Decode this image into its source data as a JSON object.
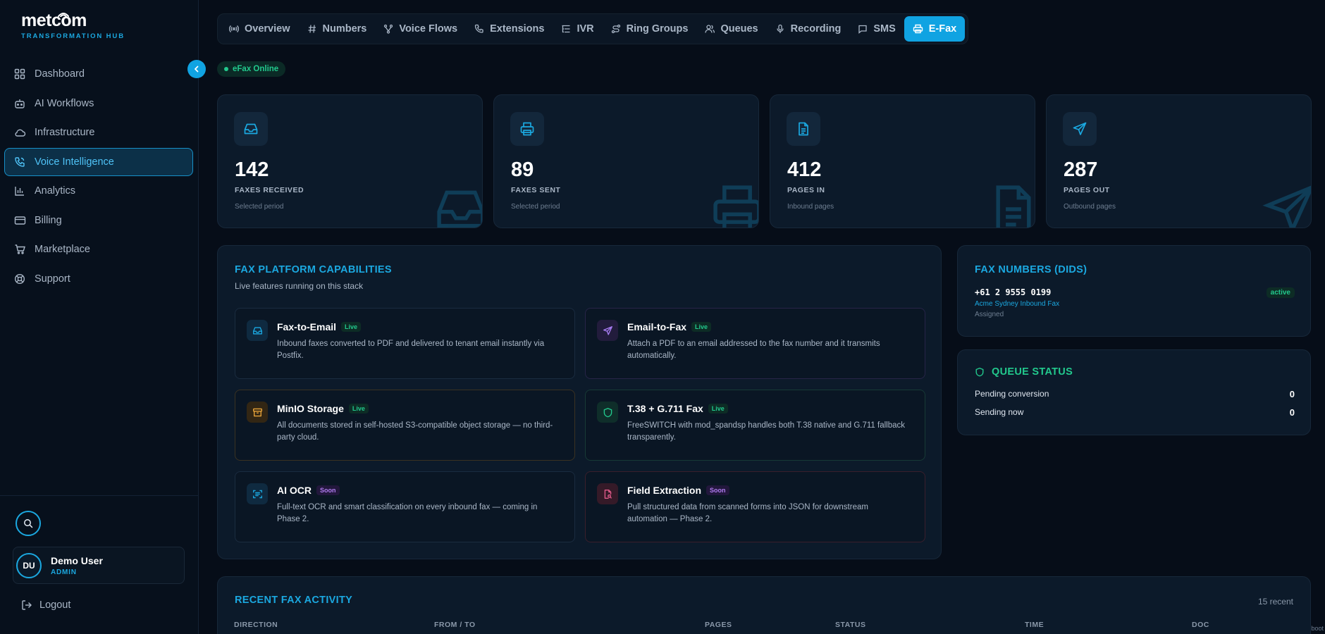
{
  "brand": {
    "name": "metcom",
    "subtitle": "TRANSFORMATION HUB"
  },
  "sidebar": {
    "items": [
      {
        "label": "Dashboard",
        "icon": "dashboard-icon",
        "active": false
      },
      {
        "label": "AI Workflows",
        "icon": "robot-icon",
        "active": false
      },
      {
        "label": "Infrastructure",
        "icon": "cloud-icon",
        "active": false
      },
      {
        "label": "Voice Intelligence",
        "icon": "phone-wave-icon",
        "active": true
      },
      {
        "label": "Analytics",
        "icon": "bar-chart-icon",
        "active": false
      },
      {
        "label": "Billing",
        "icon": "credit-card-icon",
        "active": false
      },
      {
        "label": "Marketplace",
        "icon": "cart-icon",
        "active": false
      },
      {
        "label": "Support",
        "icon": "lifebuoy-icon",
        "active": false
      }
    ],
    "user": {
      "initials": "DU",
      "name": "Demo User",
      "role": "ADMIN"
    },
    "logout_label": "Logout"
  },
  "tabs": [
    {
      "label": "Overview",
      "icon": "broadcast-icon",
      "active": false
    },
    {
      "label": "Numbers",
      "icon": "hash-icon",
      "active": false
    },
    {
      "label": "Voice Flows",
      "icon": "flow-icon",
      "active": false
    },
    {
      "label": "Extensions",
      "icon": "phone-icon",
      "active": false
    },
    {
      "label": "IVR",
      "icon": "list-tree-icon",
      "active": false
    },
    {
      "label": "Ring Groups",
      "icon": "route-icon",
      "active": false
    },
    {
      "label": "Queues",
      "icon": "users-icon",
      "active": false
    },
    {
      "label": "Recording",
      "icon": "mic-icon",
      "active": false
    },
    {
      "label": "SMS",
      "icon": "message-icon",
      "active": false
    },
    {
      "label": "E-Fax",
      "icon": "printer-icon",
      "active": true
    }
  ],
  "status": {
    "label": "eFax Online",
    "color": "#22c98d"
  },
  "stats": [
    {
      "value": "142",
      "label": "FAXES RECEIVED",
      "sub": "Selected period",
      "icon": "inbox-icon"
    },
    {
      "value": "89",
      "label": "FAXES SENT",
      "sub": "Selected period",
      "icon": "printer-icon"
    },
    {
      "value": "412",
      "label": "PAGES IN",
      "sub": "Inbound pages",
      "icon": "document-icon"
    },
    {
      "value": "287",
      "label": "PAGES OUT",
      "sub": "Outbound pages",
      "icon": "send-icon"
    }
  ],
  "capabilities": {
    "title": "FAX PLATFORM CAPABILITIES",
    "subtitle": "Live features running on this stack",
    "items": [
      {
        "title": "Fax-to-Email",
        "badge": "Live",
        "desc": "Inbound faxes converted to PDF and delivered to tenant email instantly via Postfix.",
        "icon": "inbox-icon",
        "accent": "#1ba8e0"
      },
      {
        "title": "Email-to-Fax",
        "badge": "Live",
        "desc": "Attach a PDF to an email addressed to the fax number and it transmits automatically.",
        "icon": "send-icon",
        "accent": "#a67cf0"
      },
      {
        "title": "MinIO Storage",
        "badge": "Live",
        "desc": "All documents stored in self-hosted S3-compatible object storage — no third-party cloud.",
        "icon": "archive-icon",
        "accent": "#e8a43a"
      },
      {
        "title": "T.38 + G.711 Fax",
        "badge": "Live",
        "desc": "FreeSWITCH with mod_spandsp handles both T.38 native and G.711 fallback transparently.",
        "icon": "shield-icon",
        "accent": "#22c98d"
      },
      {
        "title": "AI OCR",
        "badge": "Soon",
        "desc": "Full-text OCR and smart classification on every inbound fax — coming in Phase 2.",
        "icon": "scan-text-icon",
        "accent": "#1ba8e0"
      },
      {
        "title": "Field Extraction",
        "badge": "Soon",
        "desc": "Pull structured data from scanned forms into JSON for downstream automation — Phase 2.",
        "icon": "file-search-icon",
        "accent": "#e05a8a"
      }
    ]
  },
  "numbers": {
    "title": "FAX NUMBERS (DIDS)",
    "items": [
      {
        "number": "+61 2 9555 0199",
        "name": "Acme Sydney Inbound Fax",
        "assignment": "Assigned",
        "status": "active"
      }
    ]
  },
  "queue": {
    "title": "QUEUE STATUS",
    "rows": [
      {
        "label": "Pending conversion",
        "value": "0"
      },
      {
        "label": "Sending now",
        "value": "0"
      }
    ]
  },
  "activity": {
    "title": "RECENT FAX ACTIVITY",
    "count_label": "15 recent",
    "columns": [
      "DIRECTION",
      "FROM / TO",
      "PAGES",
      "STATUS",
      "TIME",
      "DOC"
    ]
  },
  "corner_text": "boot"
}
